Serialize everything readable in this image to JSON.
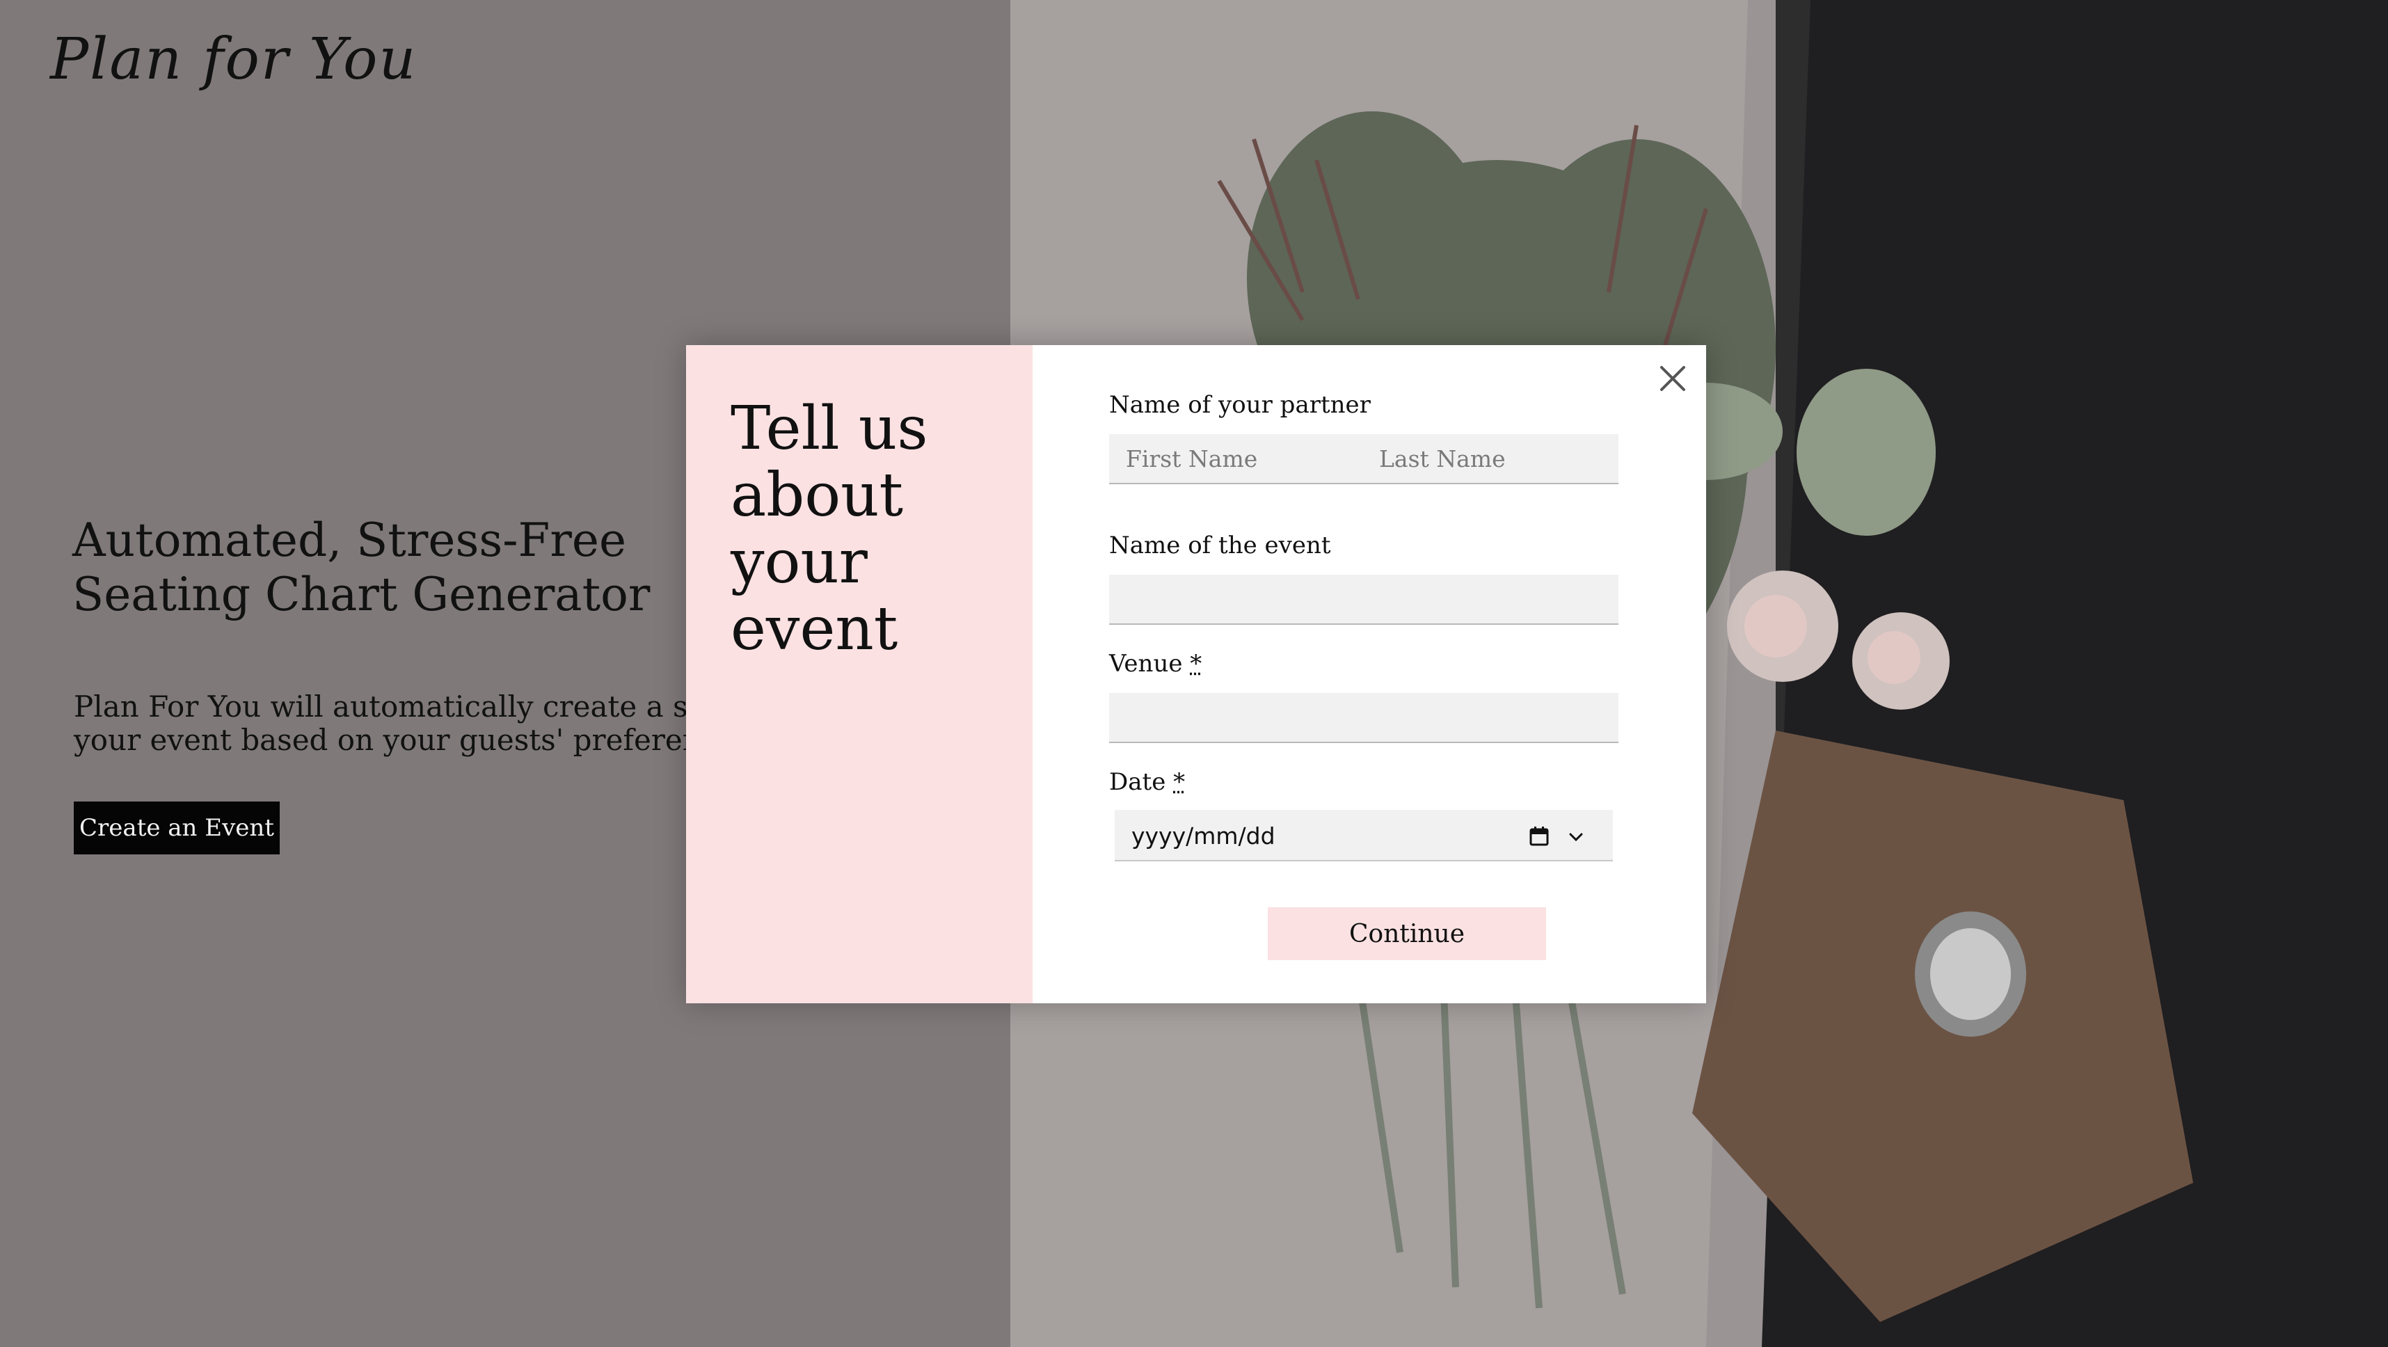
{
  "brand": {
    "logo_text": "Plan for You"
  },
  "hero": {
    "title": "Automated, Stress-Free Seating Chart Generator",
    "description_line1": "Plan For You will automatically create a seatin",
    "description_line2": "your event based on your guests' preferences",
    "cta_label": "Create an Event"
  },
  "modal": {
    "heading": "Tell us about your event",
    "close_icon": "close-icon",
    "fields": {
      "partner_label": "Name of your partner",
      "first_name_placeholder": "First Name",
      "last_name_placeholder": "Last Name",
      "event_label": "Name of the event",
      "event_value": "",
      "venue_label": "Venue",
      "venue_required": "*",
      "venue_value": "",
      "date_label": "Date",
      "date_required": "*",
      "date_placeholder": "yyyy/mm/dd"
    },
    "continue_label": "Continue"
  },
  "colors": {
    "modal_side": "#fbe1e2",
    "button_pink": "#fbe1e2",
    "cta_background": "#050505",
    "overlay_left": "#7f797a"
  }
}
